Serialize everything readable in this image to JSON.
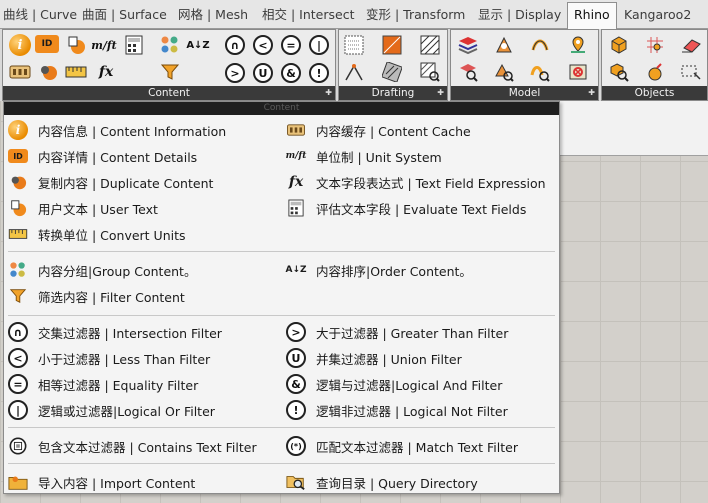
{
  "tabs": [
    {
      "label": "曲线 | Curve"
    },
    {
      "label": "曲面 | Surface"
    },
    {
      "label": "网格 | Mesh"
    },
    {
      "label": "相交 | Intersect"
    },
    {
      "label": "变形 | Transform"
    },
    {
      "label": "显示 | Display"
    },
    {
      "label": "Rhino"
    },
    {
      "label": "Kangaroo2"
    }
  ],
  "ribbon": {
    "groups": [
      {
        "label": "Content"
      },
      {
        "label": "Drafting"
      },
      {
        "label": "Model"
      },
      {
        "label": "Objects"
      }
    ],
    "content_icons": {
      "ft": "m/ft",
      "fx": "fx",
      "sort": "A↓Z",
      "and": "&",
      "union": "U",
      "intersection": "∩",
      "less": "<",
      "greater": ">",
      "equal": "=",
      "or": "|",
      "not": "!"
    }
  },
  "menu": {
    "header": "Content",
    "items": [
      {
        "label": "内容信息 | Content Information",
        "icon": "info-icon",
        "glyph": "i"
      },
      {
        "label": "内容缓存 | Content Cache",
        "icon": "cache-icon",
        "glyph": ""
      },
      {
        "label": "内容详情 | Content Details",
        "icon": "id-tag-icon",
        "glyph": "ID"
      },
      {
        "label": "单位制 | Unit System",
        "icon": "unit-icon",
        "glyph": "m/ft"
      },
      {
        "label": "复制内容 | Duplicate Content",
        "icon": "duplicate-icon",
        "glyph": ""
      },
      {
        "label": "文本字段表达式 | Text Field Expression",
        "icon": "fx-icon",
        "glyph": "fx"
      },
      {
        "label": "用户文本 | User Text",
        "icon": "user-text-icon",
        "glyph": ""
      },
      {
        "label": "评估文本字段 | Evaluate Text Fields",
        "icon": "calculator-icon",
        "glyph": ""
      },
      {
        "label": "转换单位 | Convert Units",
        "icon": "ruler-icon",
        "glyph": ""
      },
      {
        "label": "内容分组|Group Content。",
        "icon": "group-icon",
        "glyph": ""
      },
      {
        "label": "内容排序|Order Content。",
        "icon": "sort-icon",
        "glyph": "A↓Z"
      },
      {
        "label": "筛选内容 | Filter Content",
        "icon": "funnel-icon",
        "glyph": ""
      },
      {
        "label": "交集过滤器 | Intersection Filter",
        "icon": "intersection-icon",
        "glyph": "∩"
      },
      {
        "label": "大于过滤器 | Greater Than Filter",
        "icon": "greater-than-icon",
        "glyph": ">"
      },
      {
        "label": "小于过滤器 | Less Than Filter",
        "icon": "less-than-icon",
        "glyph": "<"
      },
      {
        "label": "并集过滤器 | Union Filter",
        "icon": "union-icon",
        "glyph": "U"
      },
      {
        "label": "相等过滤器 | Equality Filter",
        "icon": "equal-icon",
        "glyph": "="
      },
      {
        "label": "逻辑与过滤器|Logical And Filter",
        "icon": "and-icon",
        "glyph": "&"
      },
      {
        "label": "逻辑或过滤器|Logical Or Filter",
        "icon": "or-icon",
        "glyph": "|"
      },
      {
        "label": "逻辑非过滤器 | Logical Not Filter",
        "icon": "not-icon",
        "glyph": "!"
      },
      {
        "label": "包含文本过滤器 | Contains Text Filter",
        "icon": "contains-text-icon",
        "glyph": ""
      },
      {
        "label": "匹配文本过滤器 | Match Text Filter",
        "icon": "match-text-icon",
        "glyph": "(*)"
      },
      {
        "label": "导入内容 | Import Content",
        "icon": "folder-icon",
        "glyph": ""
      },
      {
        "label": "查询目录 | Query Directory",
        "icon": "search-folder-icon",
        "glyph": ""
      }
    ]
  }
}
